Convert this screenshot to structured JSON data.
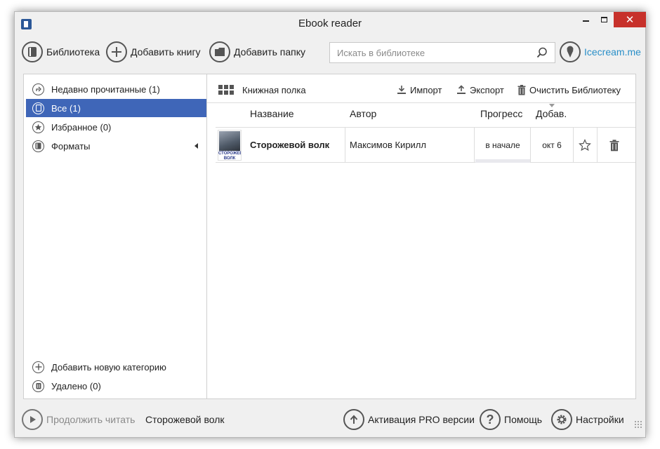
{
  "window": {
    "title": "Ebook reader",
    "controls": {
      "minimize": "",
      "maximize": "",
      "close": "✕"
    }
  },
  "toolbar": {
    "library_label": "Библиотека",
    "add_book_label": "Добавить книгу",
    "add_folder_label": "Добавить папку",
    "search_placeholder": "Искать в библиотеке",
    "brand_label": "Icecream.me"
  },
  "sidebar": {
    "items": [
      {
        "label": "Недавно прочитанные (1)",
        "icon": "recent-icon"
      },
      {
        "label": "Все (1)",
        "icon": "book-icon",
        "selected": true
      },
      {
        "label": "Избранное (0)",
        "icon": "star-icon"
      },
      {
        "label": "Форматы",
        "icon": "formats-icon"
      }
    ],
    "add_category_label": "Добавить новую категорию",
    "deleted_label": "Удалено (0)"
  },
  "content": {
    "view_label": "Книжная полка",
    "actions": {
      "import_label": "Импорт",
      "export_label": "Экспорт",
      "clear_label": "Очистить Библиотеку"
    },
    "columns": {
      "title": "Название",
      "author": "Автор",
      "progress": "Прогресс",
      "added": "Добав."
    },
    "rows": [
      {
        "title": "Сторожевой волк",
        "author": "Максимов Кирилл",
        "progress_text": "в начале",
        "progress_fraction": 0,
        "added": "окт 6",
        "cover_text": "СТОРОЖЕВОЙ ВОЛК"
      }
    ]
  },
  "statusbar": {
    "continue_label": "Продолжить читать",
    "current_book": "Сторожевой волк",
    "pro_label": "Активация PRO версии",
    "help_label": "Помощь",
    "settings_label": "Настройки"
  },
  "colors": {
    "selection": "#3f66b8",
    "brand": "#2a8fc8",
    "close_button": "#c7312b"
  }
}
